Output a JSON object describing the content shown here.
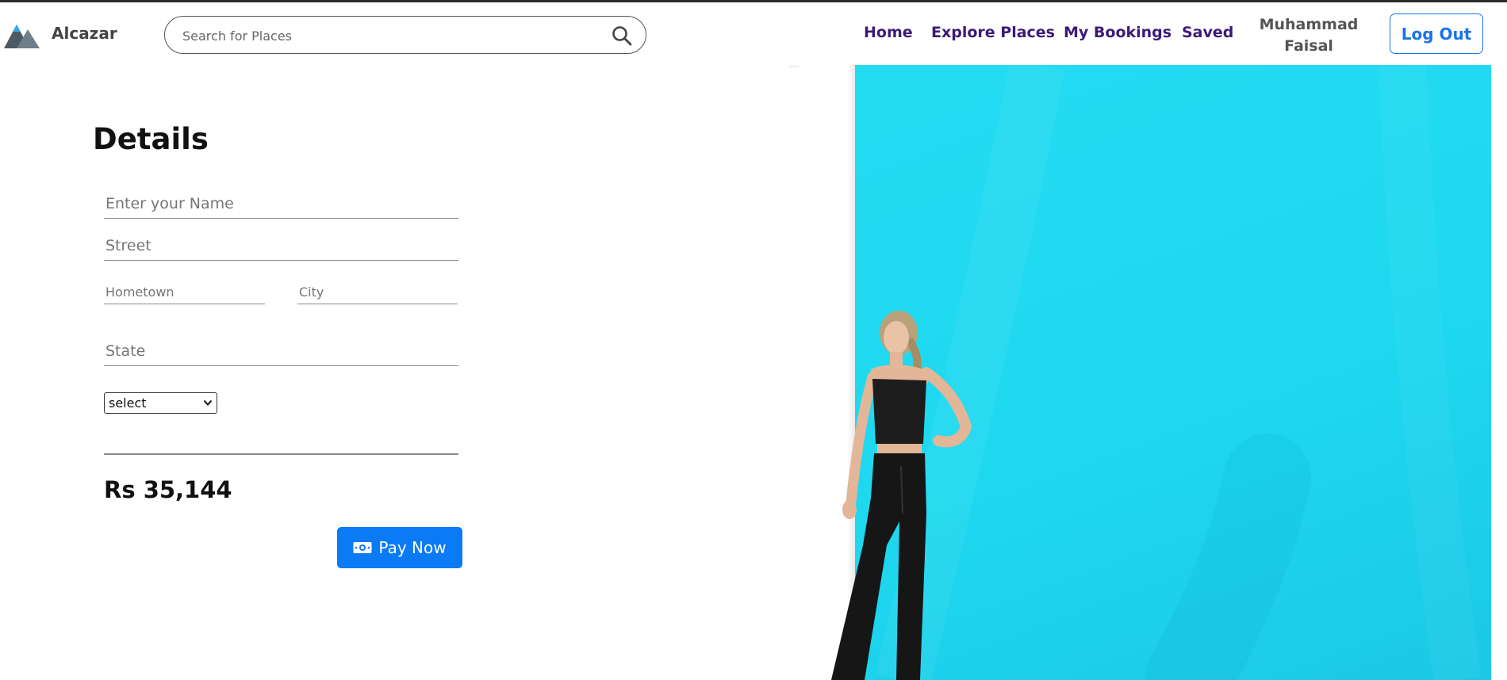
{
  "brand": {
    "name": "Alcazar",
    "logo_icon": "mountain-logo-icon"
  },
  "search": {
    "placeholder": "Search for Places",
    "value": "",
    "icon": "search-icon"
  },
  "nav": {
    "links": [
      {
        "label": "Home"
      },
      {
        "label": "Explore Places"
      },
      {
        "label": "My Bookings"
      },
      {
        "label": "Saved"
      }
    ],
    "user_name": "Muhammad Faisal",
    "logout_label": "Log Out"
  },
  "details": {
    "title": "Details",
    "name_placeholder": "Enter your Name",
    "street_placeholder": "Street",
    "hometown_placeholder": "Hometown",
    "city_placeholder": "City",
    "state_placeholder": "State",
    "select_value": "select",
    "amount": "Rs 35,144",
    "pay_label": "Pay Now",
    "pay_icon": "money-icon"
  },
  "colors": {
    "nav_link": "#3d1a78",
    "accent_blue": "#0a7af5",
    "hero_bg": "#1ed8f0"
  }
}
